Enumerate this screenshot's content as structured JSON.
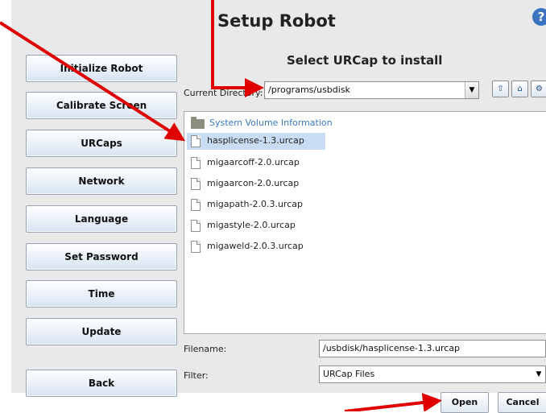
{
  "header": {
    "title": "Setup Robot",
    "help_symbol": "?"
  },
  "dialog": {
    "title": "Select URCap to install"
  },
  "sidebar": {
    "items": [
      {
        "label": "Initialize Robot"
      },
      {
        "label": "Calibrate Screen"
      },
      {
        "label": "URCaps"
      },
      {
        "label": "Network"
      },
      {
        "label": "Language"
      },
      {
        "label": "Set Password"
      },
      {
        "label": "Time"
      },
      {
        "label": "Update"
      },
      {
        "label": "Back"
      }
    ]
  },
  "directory": {
    "label": "Current Directory:",
    "value": "/programs/usbdisk",
    "buttons": [
      "up-folder-icon",
      "home-icon",
      "gear-icon"
    ]
  },
  "files": {
    "folder": "System Volume Information",
    "items": [
      {
        "name": "hasplicense-1.3.urcap",
        "selected": true
      },
      {
        "name": "migaarcoff-2.0.urcap"
      },
      {
        "name": "migaarcon-2.0.urcap"
      },
      {
        "name": "migapath-2.0.3.urcap"
      },
      {
        "name": "migastyle-2.0.urcap"
      },
      {
        "name": "migaweld-2.0.3.urcap"
      }
    ]
  },
  "filename": {
    "label": "Filename:",
    "value": "/usbdisk/hasplicense-1.3.urcap"
  },
  "filter": {
    "label": "Filter:",
    "value": "URCap Files"
  },
  "actions": {
    "open": "Open",
    "cancel": "Cancel"
  },
  "colors": {
    "accent": "#3b73c0",
    "selection": "#c8ddf3",
    "annotation_arrow": "#e00000"
  }
}
